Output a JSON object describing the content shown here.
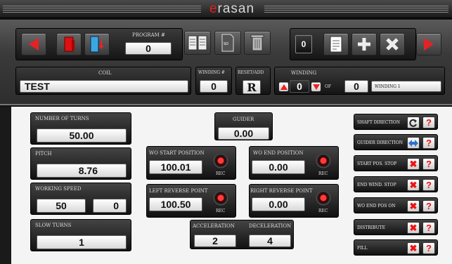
{
  "app": {
    "brand_e": "e",
    "brand_rest": "rasan"
  },
  "toolbar": {
    "program_label": "PROGRAM #",
    "program_value": "0",
    "counter_value": "0",
    "coil_label": "COIL",
    "coil_value": "TEST",
    "winding_num_label": "WINDING #",
    "winding_num_value": "0",
    "reset_label": "RESET/ADD",
    "reset_button": "R",
    "winding_label": "WINDING",
    "winding_value": "0",
    "of_label": "OF",
    "of_value": "0",
    "winding_name": "WINDING 1"
  },
  "main": {
    "turns_label": "NUMBER OF TURNS",
    "turns_value": "50.00",
    "pitch_label": "PITCH",
    "pitch_value": "8.76",
    "speed_label": "WORKING SPEED",
    "speed_value_1": "50",
    "speed_value_2": "0",
    "slow_label": "SLOW TURNS",
    "slow_value": "1",
    "guider_label": "GUIDER",
    "guider_value": "0.00",
    "wo_start_label": "WO START POSITION",
    "wo_start_value": "100.01",
    "wo_end_label": "WO END POSITION",
    "wo_end_value": "0.00",
    "left_rev_label": "LEFT REVERSE POINT",
    "left_rev_value": "100.50",
    "right_rev_label": "RIGHT REVERSE POINT",
    "right_rev_value": "0.00",
    "rec_label": "REC",
    "accel_label": "ACCELERATION",
    "accel_value": "2",
    "decel_label": "DECELERATION",
    "decel_value": "4"
  },
  "side": [
    {
      "label": "SHAFT DIRECTION",
      "state_icon": "rotate-icon"
    },
    {
      "label": "GUIDER DIRECTION",
      "state_icon": "double-arrow-icon"
    },
    {
      "label": "START POS. STOP",
      "state_icon": "x-icon"
    },
    {
      "label": "END WIND. STOP",
      "state_icon": "x-icon"
    },
    {
      "label": "WO END POS ON",
      "state_icon": "x-icon"
    },
    {
      "label": "DISTRIBUTE",
      "state_icon": "x-icon"
    },
    {
      "label": "FILL",
      "state_icon": "x-icon"
    }
  ],
  "colors": {
    "accent": "#e52222",
    "panel": "#2a2a2a",
    "field": "#ffffff"
  }
}
